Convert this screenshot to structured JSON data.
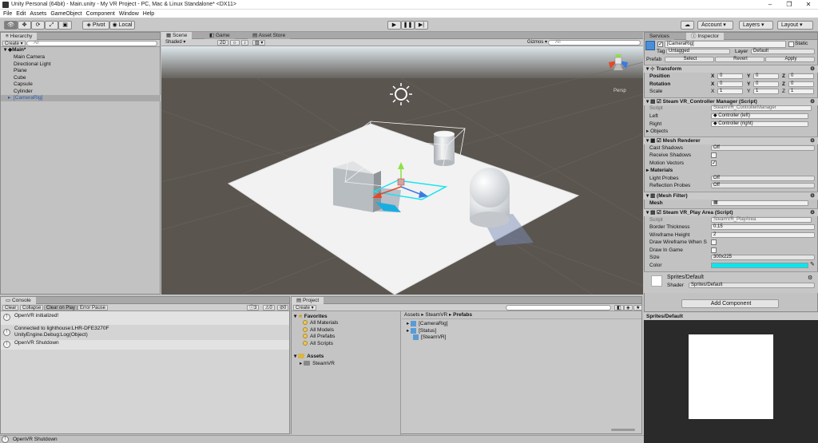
{
  "window": {
    "title": "Unity Personal (64bit) - Main.unity - My VR Project - PC, Mac & Linux Standalone* <DX11>"
  },
  "menu": [
    "File",
    "Edit",
    "Assets",
    "GameObject",
    "Component",
    "Window",
    "Help"
  ],
  "toolbar": {
    "pivot": "Pivot",
    "local": "Local",
    "account": "Account",
    "layers": "Layers",
    "layout": "Layout"
  },
  "hierarchy": {
    "tab": "Hierarchy",
    "create": "Create",
    "search": "All",
    "scene": "Main*",
    "items": [
      "Main Camera",
      "Directional Light",
      "Plane",
      "Cube",
      "Capsule",
      "Cylinder",
      "[CameraRig]"
    ]
  },
  "scene": {
    "tab": "Scene",
    "game_tab": "Game",
    "asset_tab": "Asset Store",
    "shaded": "Shaded",
    "mode2d": "2D",
    "gizmos": "Gizmos",
    "search": "All",
    "persp": "Persp"
  },
  "inspector": {
    "services_tab": "Services",
    "tab": "Inspector",
    "object_name": "[CameraRig]",
    "static": "Static",
    "tag_label": "Tag",
    "tag": "Untagged",
    "layer_label": "Layer",
    "layer": "Default",
    "prefab_label": "Prefab",
    "select": "Select",
    "revert": "Revert",
    "apply": "Apply",
    "transform": {
      "title": "Transform",
      "position": "Position",
      "rotation": "Rotation",
      "scale": "Scale",
      "x": "X",
      "y": "Y",
      "z": "Z",
      "pos": [
        "0",
        "0",
        "0"
      ],
      "rot": [
        "0",
        "0",
        "0"
      ],
      "scl": [
        "1",
        "1",
        "1"
      ]
    },
    "controller": {
      "title": "Steam VR_Controller Manager (Script)",
      "script_label": "Script",
      "script": "SteamVR_ControllerManager",
      "left_label": "Left",
      "left": "Controller (left)",
      "right_label": "Right",
      "right": "Controller (right)",
      "objects": "Objects"
    },
    "mesh_renderer": {
      "title": "Mesh Renderer",
      "cast_label": "Cast Shadows",
      "cast": "Off",
      "receive": "Receive Shadows",
      "motion": "Motion Vectors",
      "materials": "Materials",
      "light_label": "Light Probes",
      "light": "Off",
      "refl_label": "Reflection Probes",
      "refl": "Off"
    },
    "mesh_filter": {
      "title": "(Mesh Filter)",
      "mesh": "Mesh"
    },
    "play_area": {
      "title": "Steam VR_Play Area (Script)",
      "script_label": "Script",
      "script": "SteamVR_PlayArea",
      "border_label": "Border Thickness",
      "border": "0.15",
      "wire_label": "Wireframe Height",
      "wire": "2",
      "drawwhen": "Draw Wireframe When S",
      "drawin": "Draw In Game",
      "size_label": "Size",
      "size": "300x225",
      "color_label": "Color",
      "color": "#00e8f0"
    },
    "material": {
      "name": "Sprites/Default",
      "shader_label": "Shader",
      "shader": "Sprites/Default"
    },
    "add_component": "Add Component"
  },
  "preview": {
    "title": "Sprites/Default"
  },
  "console": {
    "tab": "Console",
    "clear": "Clear",
    "collapse": "Collapse",
    "clear_on_play": "Clear on Play",
    "error_pause": "Error Pause",
    "counts": [
      "3",
      "0",
      "0"
    ],
    "entries": [
      [
        "OpenVR initialized!"
      ],
      [
        "Connected to lighthouse:LHR-DFE3270F",
        "UnityEngine.Debug:Log(Object)"
      ],
      [
        "OpenVR Shutdown"
      ]
    ]
  },
  "project": {
    "tab": "Project",
    "create": "Create",
    "favorites": "Favorites",
    "fav_items": [
      "All Materials",
      "All Models",
      "All Prefabs",
      "All Scripts"
    ],
    "assets": "Assets",
    "asset_items": [
      "SteamVR"
    ],
    "breadcrumb": [
      "Assets",
      "SteamVR",
      "Prefabs"
    ],
    "files": [
      "[CameraRig]",
      "[Status]",
      "[SteamVR]"
    ]
  },
  "statusbar": {
    "text": "OpenVR Shutdown"
  }
}
